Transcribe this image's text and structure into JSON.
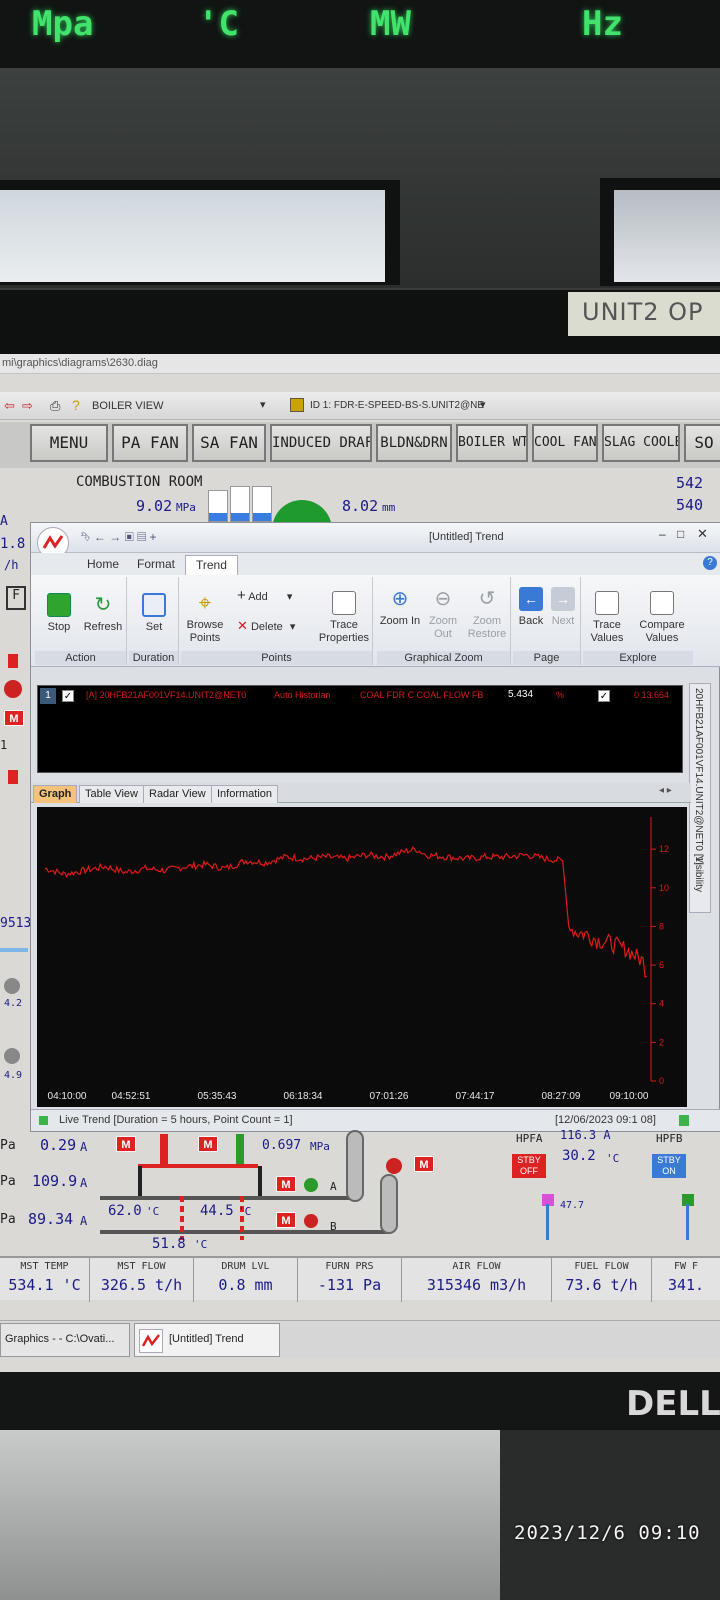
{
  "led_units": [
    "Mpa",
    "'C",
    "MW",
    "Hz"
  ],
  "unit_label": "UNIT2  OP",
  "url_path": "mi\\graphics\\diagrams\\2630.diag",
  "toolbar": {
    "view_name": "BOILER VIEW",
    "point_id": "ID 1: FDR-E-SPEED-BS-S.UNIT2@NE"
  },
  "nav_buttons": [
    "MENU",
    "PA FAN",
    "SA FAN",
    "INDUCED DRAFT",
    "BLDN&DRN",
    "BOILER WTR",
    "COOL FAN",
    "SLAG COOLER",
    "SO"
  ],
  "diagram": {
    "title": "COMBUSTION ROOM",
    "p1_value": "9.02",
    "p1_unit": "MPa",
    "p2_value": "8.02",
    "p2_unit": "mm",
    "right_top1": "542",
    "right_top2": "540",
    "left_a": "A",
    "left_num": "1.8",
    "left_th": "/h",
    "left_f": "F",
    "left_1": "1",
    "left_9513": "9513",
    "left_42": "4.2",
    "left_49": "4.9",
    "row_pa1": "Pa",
    "row_pa1_val": "0.29",
    "row_pa1_unit": "A",
    "row_pa2": "Pa",
    "row_pa2_val": "109.9",
    "row_pa2_unit": "A",
    "row_pa3": "Pa",
    "row_pa3_val": "89.34",
    "row_pa3_unit": "A",
    "mpa_a": "0.697",
    "mpa_unit": "MPa",
    "temp1": "62.0",
    "temp2": "44.5",
    "temp3": "51.8",
    "temp_unit": "'C",
    "label_a": "A",
    "label_b": "B",
    "hpfa": "HPFA",
    "hpfa_amp": "116.3 A",
    "hpfa_temp": "30.2",
    "hpfb": "HPFB",
    "stby_off": "STBY OFF",
    "stby_on": "STBY ON",
    "pct": "47.7",
    "m_label": "M"
  },
  "trend": {
    "window_title": "[Untitled] Trend",
    "tabs": [
      "Home",
      "Format",
      "Trend"
    ],
    "groups": {
      "action": {
        "label": "Action",
        "stop": "Stop",
        "refresh": "Refresh"
      },
      "duration": {
        "label": "Duration",
        "set": "Set"
      },
      "points": {
        "label": "Points",
        "browse": "Browse Points",
        "add": "Add",
        "delete": "Delete",
        "trace_props": "Trace Properties"
      },
      "zoom": {
        "label": "Graphical Zoom",
        "zoom_in": "Zoom In",
        "zoom_out": "Zoom Out",
        "zoom_restore": "Zoom Restore"
      },
      "page": {
        "label": "Page",
        "back": "Back",
        "next": "Next"
      },
      "explore": {
        "label": "Explore",
        "trace_values": "Trace Values",
        "compare_values": "Compare Values"
      }
    },
    "legend_row": {
      "index": "1",
      "tag": "[A] 20HFB21AF001VF14.UNIT2@NET0",
      "source": "Auto Historian",
      "description": "COAL FDR C COAL FLOW FB",
      "value": "5.434",
      "unit": "%",
      "range": "0   13.664"
    },
    "side_label": "20HFB21AF001VF14.UNIT2@NET0 [1]",
    "side_visibility": "Visibility",
    "graph_tabs": [
      "Graph",
      "Table View",
      "Radar View",
      "Information"
    ],
    "status": "Live Trend [Duration = 5 hours, Point Count = 1]",
    "status_time": "[12/06/2023 09:1  08]"
  },
  "chart_data": {
    "type": "line",
    "title": "",
    "xlabel": "",
    "ylabel": "",
    "x_ticks": [
      "04:10:00",
      "04:52:51",
      "05:35:43",
      "06:18:34",
      "07:01:26",
      "07:44:17",
      "08:27:09",
      "09:10:00"
    ],
    "y_ticks": [
      0,
      2,
      4,
      6,
      8,
      10,
      12
    ],
    "ylim": [
      0,
      13.664
    ],
    "xlim_minutes": [
      0,
      300
    ],
    "series": [
      {
        "color": "#e01818",
        "points": [
          [
            0,
            11.0
          ],
          [
            10,
            10.7
          ],
          [
            20,
            10.9
          ],
          [
            30,
            11.1
          ],
          [
            40,
            10.8
          ],
          [
            50,
            11.0
          ],
          [
            60,
            10.9
          ],
          [
            70,
            11.1
          ],
          [
            80,
            11.2
          ],
          [
            90,
            11.0
          ],
          [
            100,
            11.4
          ],
          [
            110,
            11.3
          ],
          [
            120,
            11.6
          ],
          [
            130,
            11.5
          ],
          [
            140,
            11.6
          ],
          [
            150,
            11.5
          ],
          [
            160,
            11.7
          ],
          [
            170,
            11.6
          ],
          [
            180,
            11.9
          ],
          [
            185,
            12.0
          ],
          [
            190,
            11.7
          ],
          [
            200,
            11.6
          ],
          [
            210,
            11.5
          ],
          [
            220,
            11.6
          ],
          [
            230,
            11.6
          ],
          [
            240,
            11.7
          ],
          [
            250,
            11.5
          ],
          [
            258,
            11.4
          ],
          [
            261,
            8.0
          ],
          [
            265,
            7.7
          ],
          [
            270,
            7.6
          ],
          [
            275,
            7.3
          ],
          [
            280,
            7.2
          ],
          [
            285,
            7.0
          ],
          [
            290,
            6.8
          ],
          [
            294,
            6.5
          ],
          [
            298,
            6.2
          ],
          [
            300,
            5.434
          ]
        ]
      }
    ],
    "grid": false,
    "legend": "none"
  },
  "bottom_metrics": [
    {
      "label": "MST TEMP",
      "value": "534.1 'C"
    },
    {
      "label": "MST FLOW",
      "value": "326.5 t/h"
    },
    {
      "label": "DRUM LVL",
      "value": "0.8 mm"
    },
    {
      "label": "FURN PRS",
      "value": "-131 Pa"
    },
    {
      "label": "AIR FLOW",
      "value": "315346 m3/h"
    },
    {
      "label": "FUEL FLOW",
      "value": "73.6 t/h"
    },
    {
      "label": "FW F",
      "value": "341."
    }
  ],
  "taskbar": [
    "Graphics - - C:\\Ovati...",
    "[Untitled] Trend"
  ],
  "brand": "DELL",
  "timestamp": "2023/12/6 09:10",
  "colors": {
    "trend_line": "#e01818",
    "led": "#41e36a",
    "alarm_red": "#d22222"
  }
}
